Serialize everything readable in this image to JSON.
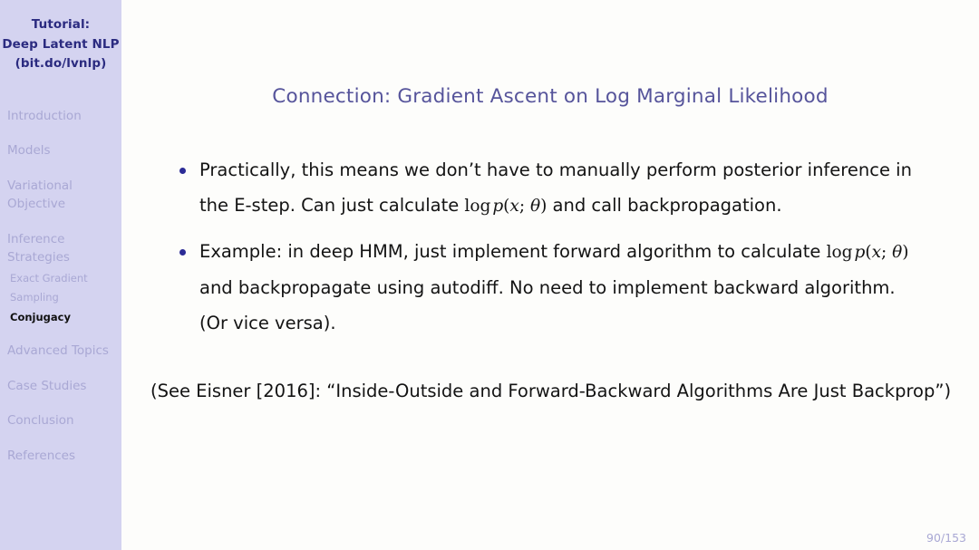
{
  "sidebar": {
    "title_lines": [
      "Tutorial:",
      "Deep Latent NLP",
      "(bit.do/lvnlp)"
    ],
    "sections": [
      {
        "label": "Introduction",
        "lines": [
          "Introduction"
        ],
        "active": false
      },
      {
        "label": "Models",
        "lines": [
          "Models"
        ],
        "active": false
      },
      {
        "label": "Variational Objective",
        "lines": [
          "Variational",
          "Objective"
        ],
        "active": false
      },
      {
        "label": "Inference Strategies",
        "lines": [
          "Inference",
          "Strategies"
        ],
        "active": false
      }
    ],
    "subsections": [
      {
        "label": "Exact Gradient",
        "active": false
      },
      {
        "label": "Sampling",
        "active": false
      },
      {
        "label": "Conjugacy",
        "active": true
      }
    ],
    "sections_after": [
      {
        "label": "Advanced Topics",
        "lines": [
          "Advanced Topics"
        ],
        "active": false
      },
      {
        "label": "Case Studies",
        "lines": [
          "Case Studies"
        ],
        "active": false
      },
      {
        "label": "Conclusion",
        "lines": [
          "Conclusion"
        ],
        "active": false
      },
      {
        "label": "References",
        "lines": [
          "References"
        ],
        "active": false
      }
    ]
  },
  "slide": {
    "title": "Connection: Gradient Ascent on Log Marginal Likelihood",
    "bullets": [
      {
        "part1": "Practically, this means we don’t have to manually perform posterior inference in the E-step. Can just calculate ",
        "math": "log p(x; θ)",
        "part2": " and call backpropagation."
      },
      {
        "part1": "Example: in deep HMM, just implement forward algorithm to calculate ",
        "math": "log p(x; θ)",
        "part2": " and backpropagate using autodiff. No need to implement backward algorithm. (Or vice versa)."
      }
    ],
    "paragraph": "(See Eisner [2016]: “Inside-Outside and Forward-Backward Algorithms Are Just Backprop”)",
    "page_number": "90/153"
  },
  "colors": {
    "sidebar_bg": "#d4d3f0",
    "slide_bg": "#fdfdfb",
    "title_text": "#56549b",
    "sidebar_title_text": "#2b2b80",
    "sidebar_inactive_text": "#a9a8d4",
    "sidebar_active_text": "#111111",
    "bullet_dot": "#2b2b96",
    "body_text": "#131313",
    "page_number_text": "#a9a8d4"
  }
}
